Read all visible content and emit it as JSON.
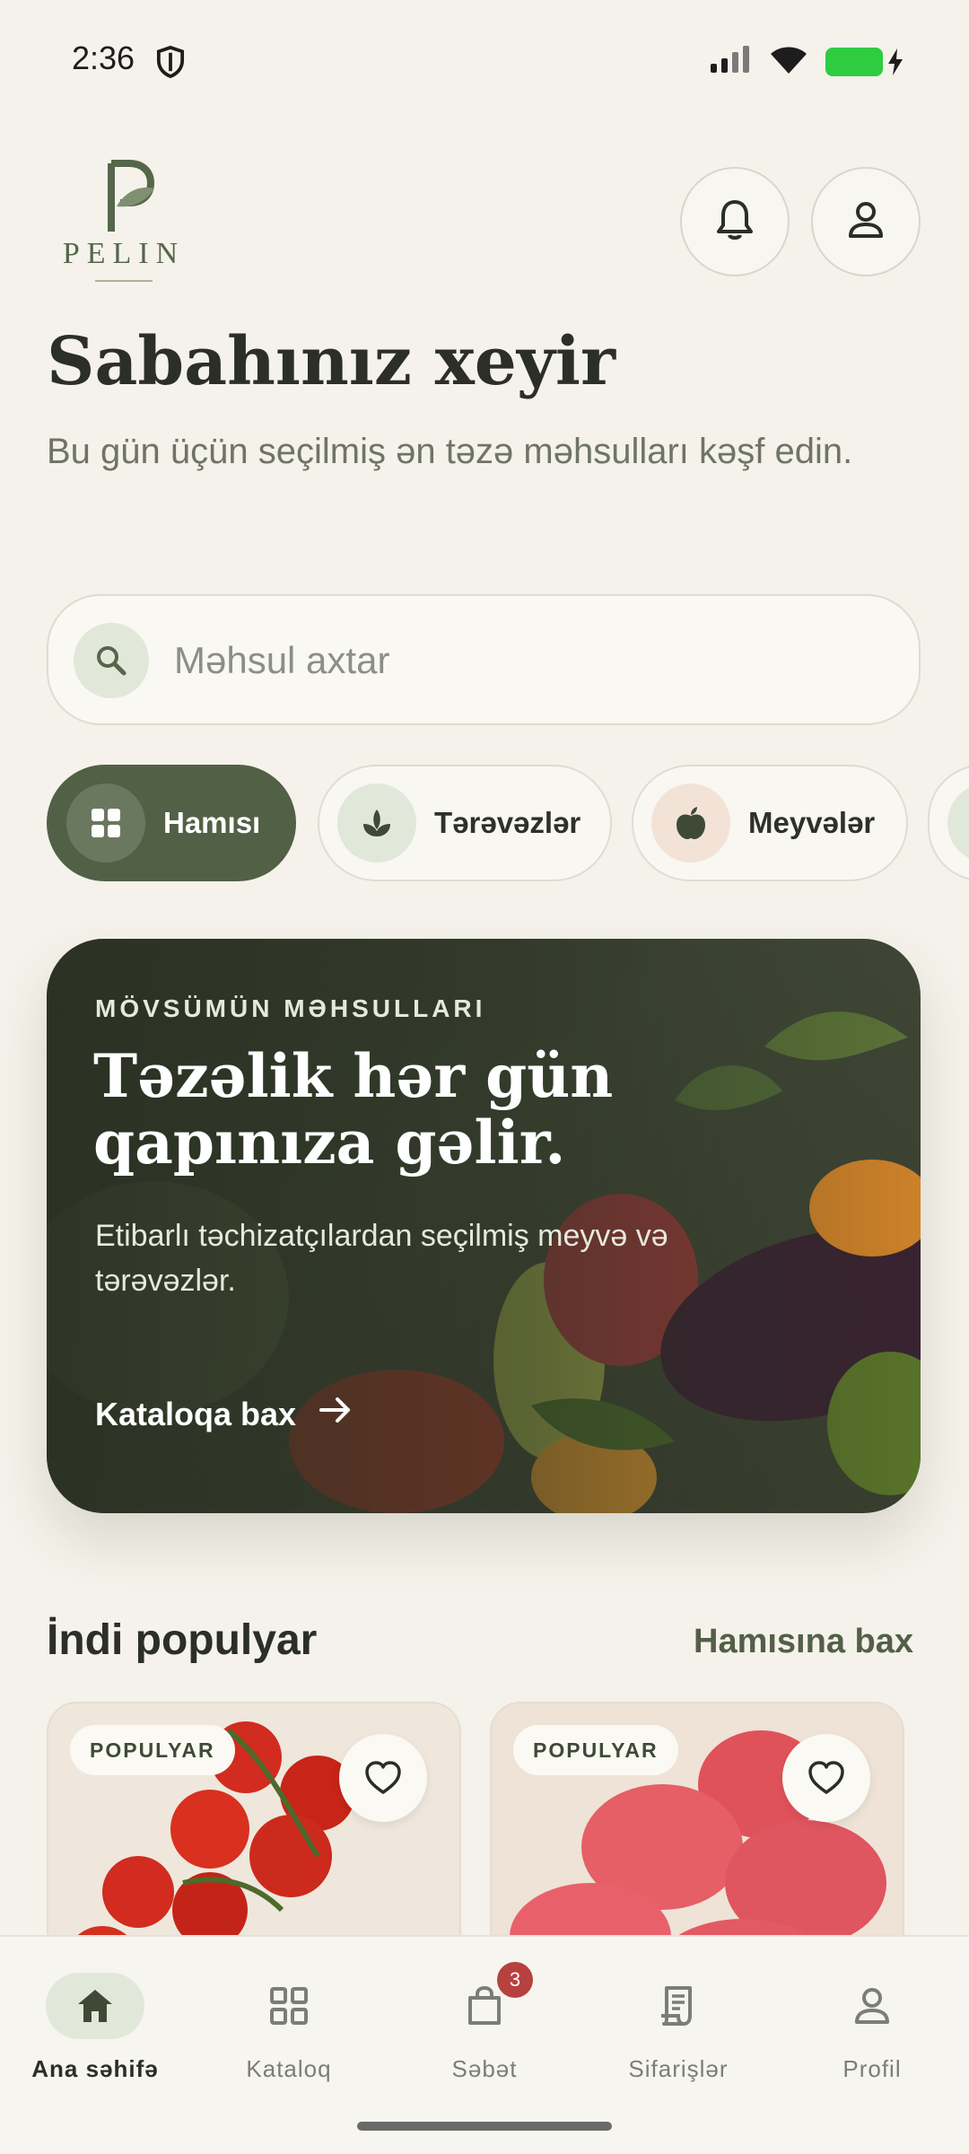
{
  "status_bar": {
    "time": "2:36"
  },
  "brand": {
    "name": "PELIN",
    "accent": "#526046",
    "badge_color": "#b6413f"
  },
  "header": {
    "greeting": "Sabahınız xeyir",
    "subtitle": "Bu gün üçün seçilmiş ən təzə məhsulları kəşf edin."
  },
  "search": {
    "placeholder": "Məhsul axtar"
  },
  "categories": [
    {
      "label": "Hamısı",
      "icon": "grid-icon",
      "active": true
    },
    {
      "label": "Tərəvəzlər",
      "icon": "sprout-icon",
      "active": false
    },
    {
      "label": "Meyvələr",
      "icon": "apple-icon",
      "active": false
    }
  ],
  "hero": {
    "eyebrow": "MÖVSÜMÜN MƏHSULLARI",
    "title": "Təzəlik hər gün qapınıza gəlir.",
    "description": "Etibarlı təchizatçılardan seçilmiş meyvə və tərəvəzlər.",
    "cta": "Kataloqa bax"
  },
  "popular": {
    "title": "İndi populyar",
    "see_all": "Hamısına bax",
    "products": [
      {
        "badge": "POPULYAR",
        "favorite": false
      },
      {
        "badge": "POPULYAR",
        "favorite": false
      }
    ]
  },
  "nav": {
    "items": [
      {
        "label": "Ana səhifə",
        "icon": "home-icon",
        "active": true
      },
      {
        "label": "Kataloq",
        "icon": "grid-icon",
        "active": false
      },
      {
        "label": "Səbət",
        "icon": "bag-icon",
        "active": false,
        "badge": "3"
      },
      {
        "label": "Sifarişlər",
        "icon": "receipt-icon",
        "active": false
      },
      {
        "label": "Profil",
        "icon": "person-icon",
        "active": false
      }
    ]
  }
}
